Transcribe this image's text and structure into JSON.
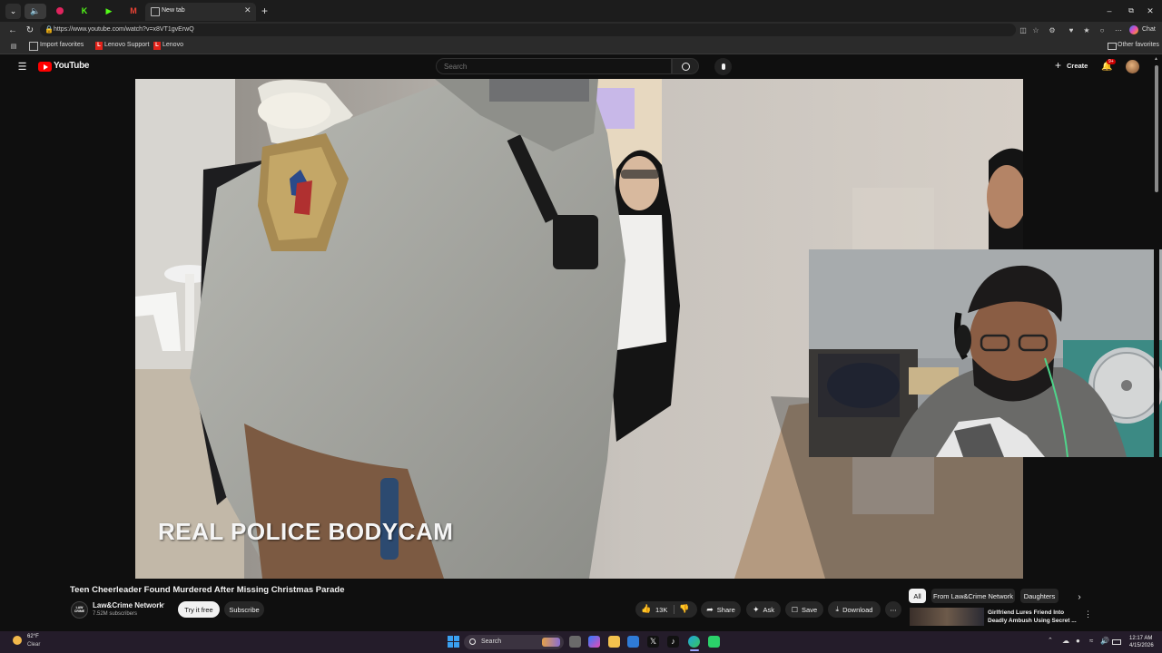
{
  "browser": {
    "tab_title": "New tab",
    "url": "https://www.youtube.com/watch?v=x8VT1gvErwQ",
    "chat_label": "Chat",
    "window_controls": [
      "minimize",
      "restore",
      "close"
    ],
    "favorites": [
      {
        "label": "Import favorites",
        "icon": "import-icon"
      },
      {
        "label": "Lenovo Support",
        "icon": "lenovo-icon"
      },
      {
        "label": "Lenovo",
        "icon": "lenovo-icon"
      }
    ],
    "other_favorites": "Other favorites"
  },
  "youtube": {
    "logo_text": "YouTube",
    "search_placeholder": "Search",
    "create_label": "Create",
    "notification_badge": "9+",
    "video": {
      "overlay_text": "REAL POLICE BODYCAM",
      "title": "Teen Cheerleader Found Murdered After Missing Christmas Parade",
      "channel": "Law&Crime Network",
      "channel_avatar_text": "LAW CRIME",
      "subscribers": "7.52M subscribers",
      "try_label": "Try it free",
      "subscribe_label": "Subscribe",
      "likes": "13K",
      "share_label": "Share",
      "ask_label": "Ask",
      "save_label": "Save",
      "download_label": "Download"
    },
    "chips": [
      "All",
      "From Law&Crime Network",
      "Daughters"
    ],
    "recommendation": {
      "title_line1": "Girlfriend Lures Friend Into",
      "title_line2": "Deadly Ambush Using Secret ..."
    }
  },
  "taskbar": {
    "weather_temp": "62°F",
    "weather_desc": "Clear",
    "search_label": "Search",
    "time": "12:17 AM",
    "date": "4/15/2026"
  },
  "colors": {
    "youtube_red": "#ff0000",
    "background": "#0f0f0f",
    "taskbar": "#241c2a"
  }
}
